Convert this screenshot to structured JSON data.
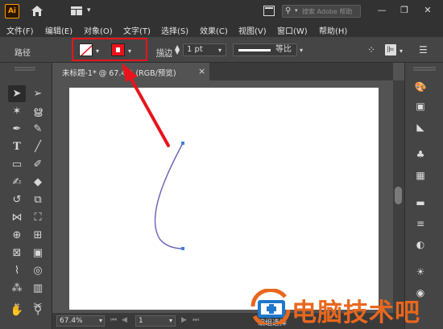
{
  "titlebar": {
    "logo": "Ai",
    "search_placeholder": "搜索 Adobe 帮助"
  },
  "menu": [
    "文件(F)",
    "编辑(E)",
    "对象(O)",
    "文字(T)",
    "选择(S)",
    "效果(C)",
    "视图(V)",
    "窗口(W)",
    "帮助(H)"
  ],
  "control": {
    "label": "路径",
    "stroke_label": "描边",
    "stroke_value": "1 pt",
    "profile_label": "等比"
  },
  "document": {
    "tab_label": "未标题-1* @ 67.4% (RGB/预览)",
    "close": "×"
  },
  "status": {
    "zoom": "67.4%",
    "page": "1",
    "tool_label": "编组选择"
  },
  "watermark": {
    "text": "电脑技术吧"
  },
  "colors": {
    "highlight": "#e8141c",
    "accent_orange": "#ff9a00",
    "path_stroke": "#6a5fb5",
    "anchor": "#3f7fd6"
  },
  "icons": {
    "tools": [
      "selection-tool-icon",
      "direct-selection-tool-icon",
      "magic-wand-tool-icon",
      "lasso-tool-icon",
      "pen-tool-icon",
      "curvature-tool-icon",
      "type-tool-icon",
      "line-segment-tool-icon",
      "rectangle-tool-icon",
      "paintbrush-tool-icon",
      "shaper-tool-icon",
      "eraser-tool-icon",
      "rotate-tool-icon",
      "scale-tool-icon",
      "width-tool-icon",
      "free-transform-tool-icon",
      "shape-builder-tool-icon",
      "perspective-grid-tool-icon",
      "mesh-tool-icon",
      "gradient-tool-icon",
      "eyedropper-tool-icon",
      "blend-tool-icon",
      "symbol-sprayer-tool-icon",
      "column-graph-tool-icon",
      "artboard-tool-icon",
      "slice-tool-icon",
      "hand-tool-icon",
      "zoom-tool-icon"
    ],
    "panels": [
      "color-panel-icon",
      "color-guide-panel-icon",
      "gradient-panel-icon",
      "swatches-panel-icon",
      "brushes-panel-icon",
      "symbols-panel-icon",
      "stroke-panel-icon",
      "transparency-panel-icon",
      "appearance-panel-icon",
      "graphic-styles-panel-icon"
    ]
  }
}
